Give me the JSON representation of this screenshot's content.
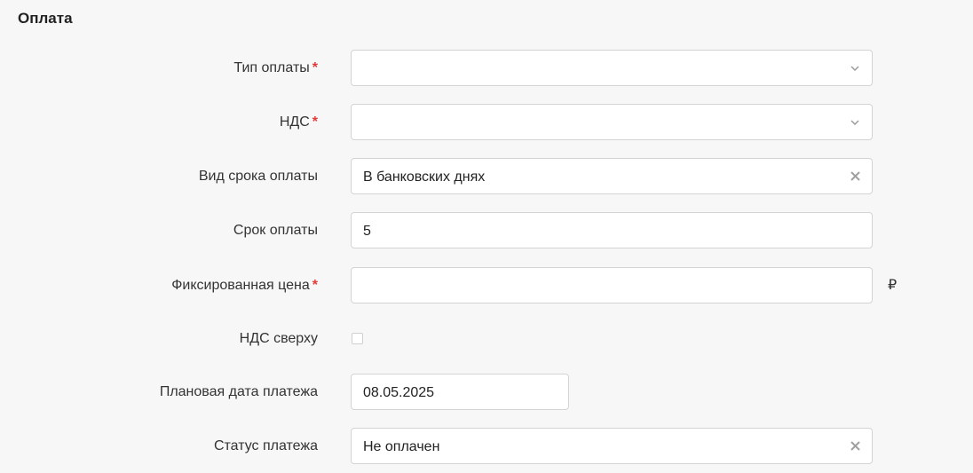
{
  "section": {
    "title": "Оплата"
  },
  "required_mark": "*",
  "fields": {
    "payment_type": {
      "label": "Тип оплаты",
      "value": ""
    },
    "vat": {
      "label": "НДС",
      "value": ""
    },
    "payment_term_kind": {
      "label": "Вид срока оплаты",
      "value": "В банковских днях"
    },
    "payment_term": {
      "label": "Срок оплаты",
      "value": "5"
    },
    "fixed_price": {
      "label": "Фиксированная цена",
      "value": "",
      "currency": "₽"
    },
    "vat_on_top": {
      "label": "НДС сверху",
      "checked": false
    },
    "planned_payment_date": {
      "label": "Плановая дата платежа",
      "value": "08.05.2025"
    },
    "payment_status": {
      "label": "Статус платежа",
      "value": "Не оплачен"
    }
  },
  "icons": {
    "dropdown": "chevron-down-icon",
    "clear": "clear-icon"
  },
  "colors": {
    "background": "#f7f7f7",
    "required": "#e03a3a",
    "border": "#d4d4d4"
  }
}
